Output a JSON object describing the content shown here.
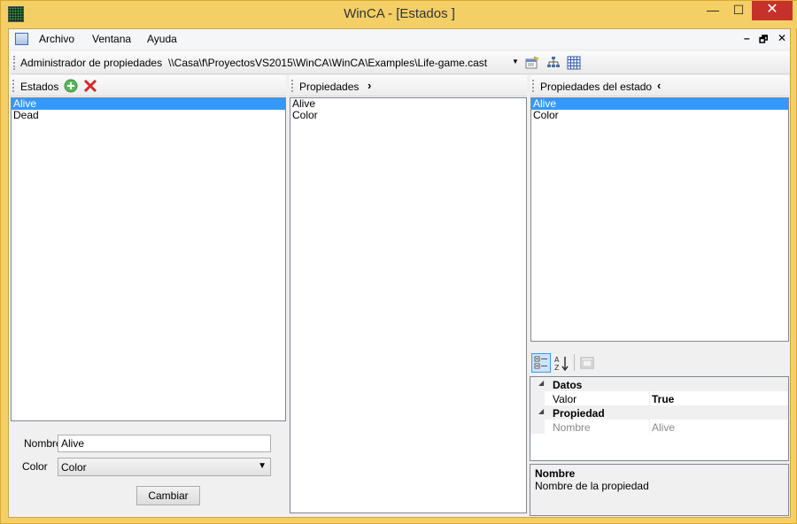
{
  "window": {
    "title": "WinCA - [Estados ]",
    "min_glyph": "—",
    "max_glyph": "☐",
    "close_glyph": "✕"
  },
  "menu": {
    "items": [
      "Archivo",
      "Ventana",
      "Ayuda"
    ],
    "mdi": {
      "min": "–",
      "restore": "🗗",
      "close": "✕"
    }
  },
  "toolbar": {
    "label": "Administrador de propiedades",
    "path": "\\\\Casa\\f\\ProyectosVS2015\\WinCA\\WinCA\\Examples\\Life-game.cast"
  },
  "estados": {
    "title": "Estados",
    "items": [
      "Alive",
      "Dead"
    ],
    "selected": 0
  },
  "propiedades": {
    "title": "Propiedades",
    "items": [
      "Alive",
      "Color"
    ]
  },
  "prop_estado": {
    "title": "Propiedades del estado",
    "items": [
      "Alive",
      "Color"
    ],
    "selected": 0
  },
  "form": {
    "nombre_label": "Nombre",
    "nombre_value": "Alive",
    "color_label": "Color",
    "color_value": "Color",
    "cambiar_label": "Cambiar"
  },
  "property_grid": {
    "categories": [
      {
        "name": "Datos",
        "rows": [
          {
            "name": "Valor",
            "value": "True"
          }
        ]
      },
      {
        "name": "Propiedad",
        "rows": [
          {
            "name": "Nombre",
            "value": "Alive"
          }
        ]
      }
    ],
    "help_title": "Nombre",
    "help_text": "Nombre de la propiedad"
  },
  "colors": {
    "selection": "#3399ff",
    "close_button": "#c7312b",
    "title_bar": "#f3cf66"
  }
}
